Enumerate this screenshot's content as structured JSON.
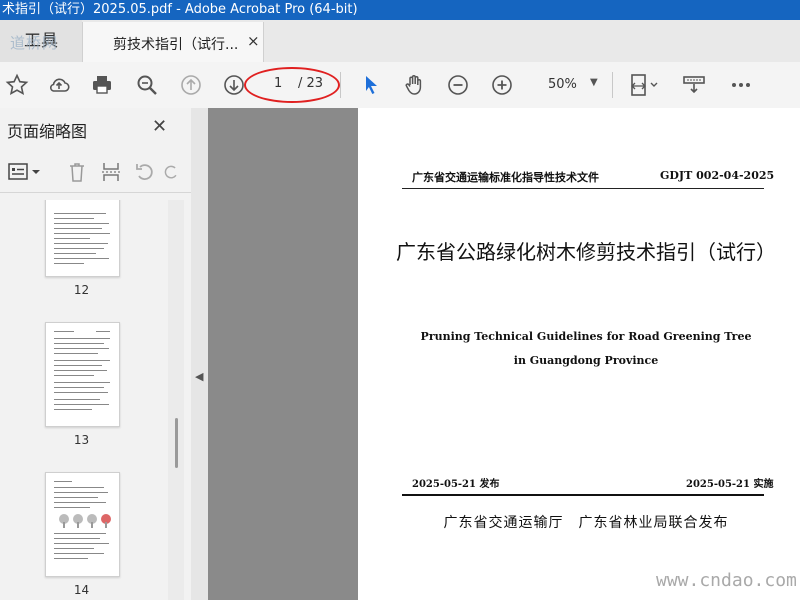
{
  "window": {
    "title": "术指引（试行）2025.05.pdf - Adobe Acrobat Pro (64-bit)"
  },
  "watermark": "道桥网",
  "tabs": {
    "tools": "工具",
    "document": "剪技术指引（试行...",
    "close_glyph": "×"
  },
  "toolbar": {
    "current_page": "1",
    "total_pages": "/ 23",
    "zoom": "50%",
    "icons": [
      "star-icon",
      "cloud-upload-icon",
      "printer-icon",
      "zoom-search-icon",
      "page-up-icon",
      "page-down-icon",
      "pointer-icon",
      "hand-icon",
      "zoom-out-icon",
      "zoom-in-icon",
      "page-fit-icon",
      "scan-icon",
      "more-icon"
    ]
  },
  "sidebar": {
    "title": "页面缩略图",
    "close_glyph": "✕",
    "thumbnails": [
      {
        "label": "12"
      },
      {
        "label": "13"
      },
      {
        "label": "14"
      }
    ]
  },
  "document": {
    "header_left": "广东省交通运输标准化指导性技术文件",
    "header_right": "GDJT 002-04-2025",
    "title": "广东省公路绿化树木修剪技术指引（试行）",
    "subtitle_en_1": "Pruning Technical Guidelines for Road Greening Tree",
    "subtitle_en_2": "in Guangdong Province",
    "publish_date": "2025-05-21 发布",
    "implement_date": "2025-05-21 实施",
    "issuer": "广东省交通运输厅　广东省林业局联合发布"
  },
  "site_watermark": "www.cndao.com",
  "colors": {
    "titlebar": "#1565c0",
    "frame": "#f5e400",
    "annotation_oval": "#e02020",
    "pointer": "#1e6fd9"
  }
}
